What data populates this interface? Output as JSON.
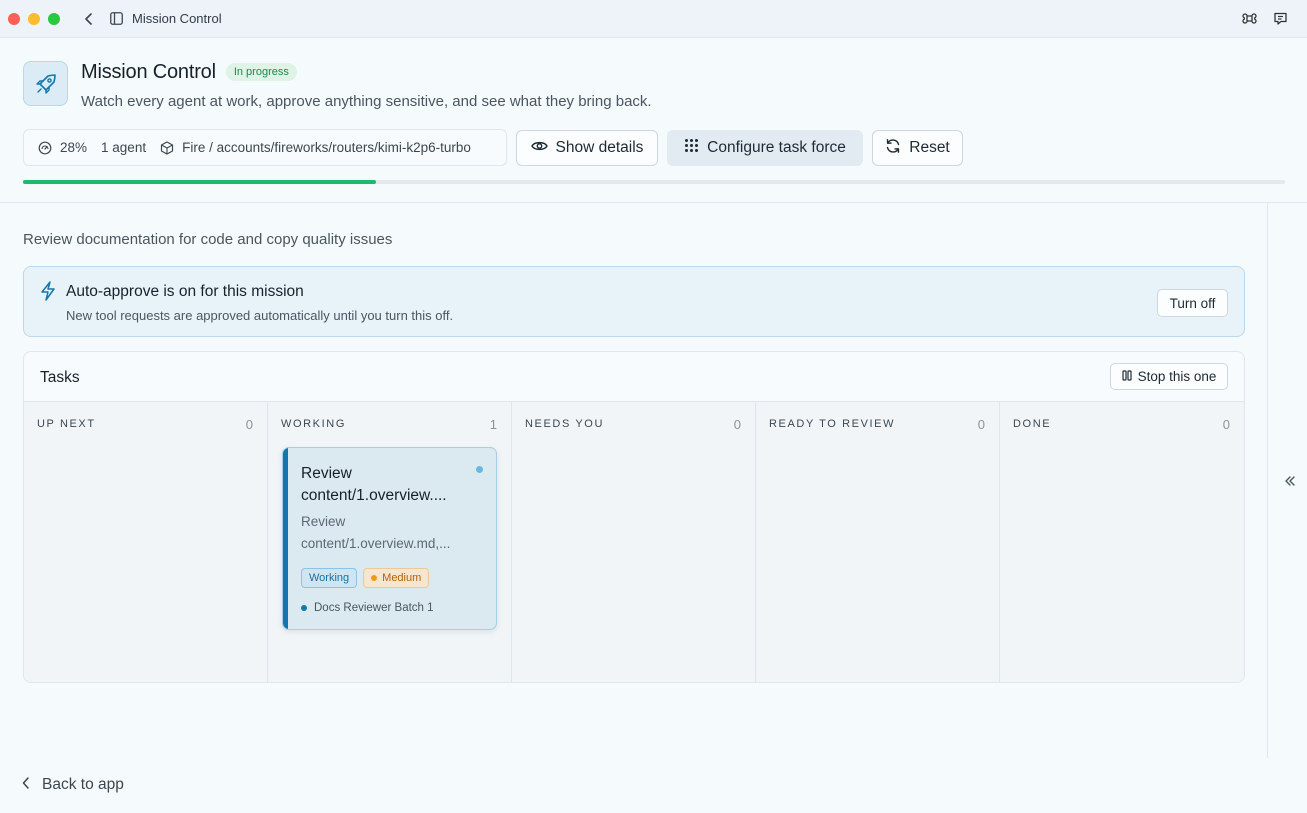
{
  "window": {
    "title": "Mission Control"
  },
  "header": {
    "title": "Mission Control",
    "status": "In progress",
    "subtitle": "Watch every agent at work, approve anything sensitive, and see what they bring back.",
    "progress_label": "28%",
    "progress_value": 0.28,
    "agents_label": "1 agent",
    "model_path": "Fire / accounts/fireworks/routers/kimi-k2p6-turbo"
  },
  "actions": {
    "show_details": "Show details",
    "configure": "Configure task force",
    "reset": "Reset"
  },
  "mission": {
    "description": "Review documentation for code and copy quality issues"
  },
  "banner": {
    "title": "Auto-approve is on for this mission",
    "text": "New tool requests are approved automatically until you turn this off.",
    "button": "Turn off"
  },
  "tasks": {
    "title": "Tasks",
    "stop_button": "Stop this one",
    "columns": [
      {
        "name": "UP NEXT",
        "count": "0"
      },
      {
        "name": "WORKING",
        "count": "1"
      },
      {
        "name": "NEEDS YOU",
        "count": "0"
      },
      {
        "name": "READY TO REVIEW",
        "count": "0"
      },
      {
        "name": "DONE",
        "count": "0"
      }
    ],
    "card": {
      "title": "Review content/1.overview....",
      "description": "Review content/1.overview.md,...",
      "status_tag": "Working",
      "priority_tag": "Medium",
      "agent": "Docs Reviewer Batch 1"
    }
  },
  "footer": {
    "back_link": "Back to app"
  },
  "colors": {
    "accent": "#1377ad",
    "progress": "#1dba6e",
    "status_green": "#1c8a4d",
    "priority_orange": "#f19a1a"
  }
}
